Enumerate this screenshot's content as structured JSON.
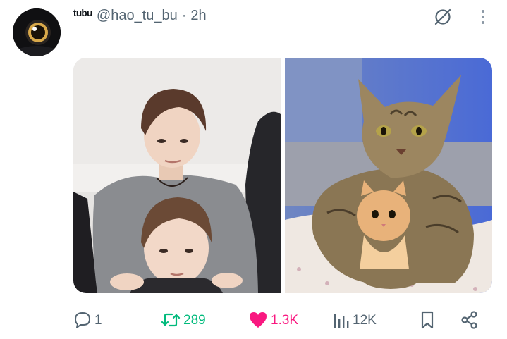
{
  "tweet": {
    "author": {
      "display_name": "ᵗᵘᵇᵘ",
      "handle": "@hao_tu_bu",
      "avatar_icon": "cartoon-eye-avatar"
    },
    "separator": "·",
    "timestamp": "2h",
    "header_icons": {
      "grok": "grok-icon",
      "more": "more-vertical-icon"
    },
    "media": [
      {
        "description_icon": "photo-two-people"
      },
      {
        "description_icon": "photo-cat-with-kitten"
      }
    ],
    "actions": {
      "reply": {
        "icon": "reply-icon",
        "count": "1"
      },
      "retweet": {
        "icon": "retweet-icon",
        "count": "289",
        "active": true,
        "color": "#00ba7c"
      },
      "like": {
        "icon": "heart-icon",
        "count": "1.3K",
        "active": true,
        "color": "#f91880"
      },
      "views": {
        "icon": "views-icon",
        "count": "12K"
      },
      "bookmark": {
        "icon": "bookmark-icon"
      },
      "share": {
        "icon": "share-icon"
      }
    }
  },
  "colors": {
    "text_primary": "#0f1419",
    "text_secondary": "#536471",
    "retweet_active": "#00ba7c",
    "like_active": "#f91880"
  }
}
